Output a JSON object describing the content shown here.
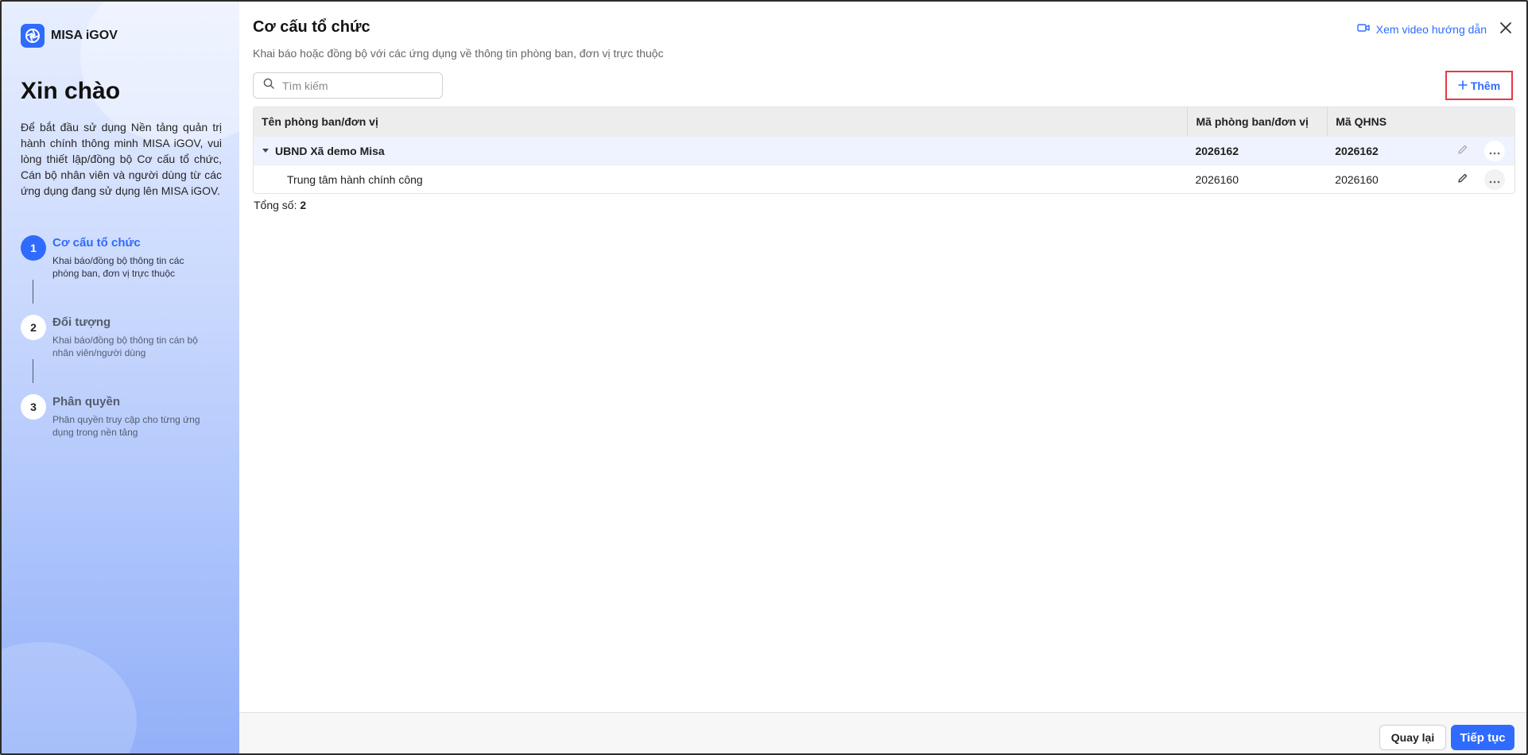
{
  "brand": {
    "name": "MISA iGOV",
    "color": "#2f6bff"
  },
  "sidebar": {
    "greeting": "Xin chào",
    "intro": "Để bắt đầu sử dụng Nền tảng quản trị hành chính thông minh MISA iGOV, vui lòng thiết lập/đồng bộ Cơ cấu tổ chức, Cán bộ nhân viên và người dùng từ các ứng dụng đang sử dụng lên MISA iGOV.",
    "steps": [
      {
        "num": "1",
        "title": "Cơ cấu tổ chức",
        "desc": "Khai báo/đồng bộ thông tin các phòng ban, đơn vị trực thuộc",
        "active": true
      },
      {
        "num": "2",
        "title": "Đối tượng",
        "desc": "Khai báo/đồng bộ thông tin cán bộ nhân viên/người dùng",
        "active": false
      },
      {
        "num": "3",
        "title": "Phân quyền",
        "desc": "Phân quyền truy cập cho từng ứng dụng trong nền tảng",
        "active": false
      }
    ]
  },
  "header": {
    "title": "Cơ cấu tổ chức",
    "subtitle": "Khai báo hoặc đồng bộ với các ứng dụng về thông tin phòng ban, đơn vị trực thuộc",
    "video_link": "Xem video hướng dẫn"
  },
  "search": {
    "placeholder": "Tìm kiếm",
    "value": ""
  },
  "add_button": "Thêm",
  "table": {
    "columns": [
      "Tên phòng ban/đơn vị",
      "Mã phòng ban/đơn vị",
      "Mã QHNS"
    ],
    "rows": [
      {
        "name": "UBND Xã demo Misa",
        "code": "2026162",
        "qhns": "2026162",
        "level": 0,
        "expanded": true
      },
      {
        "name": "Trung tâm hành chính công",
        "code": "2026160",
        "qhns": "2026160",
        "level": 1
      }
    ]
  },
  "total": {
    "label": "Tổng số:",
    "value": "2"
  },
  "footer": {
    "back": "Quay lại",
    "next": "Tiếp tục"
  },
  "icons": {
    "logo": "shutter-logo-icon",
    "video": "video-camera-icon",
    "close": "close-icon",
    "search": "search-icon",
    "add": "plus-icon",
    "edit": "pencil-icon",
    "more": "more-horizontal-icon",
    "expand": "caret-down-icon"
  }
}
